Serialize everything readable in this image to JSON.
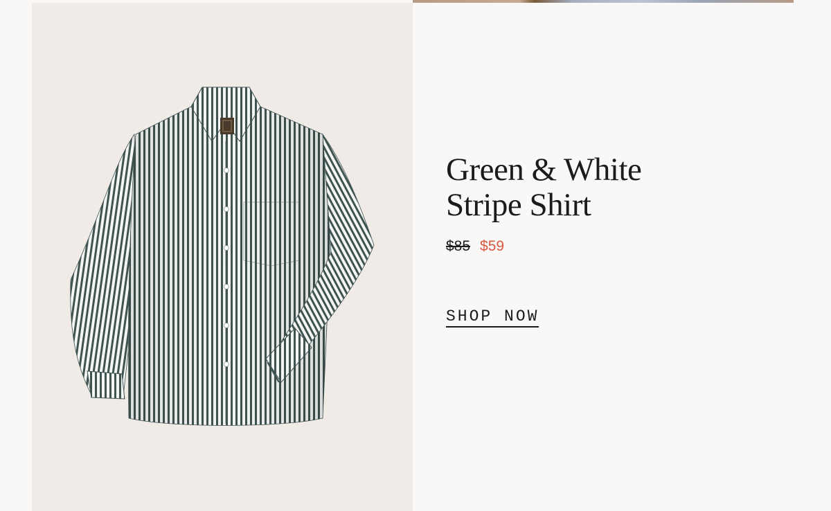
{
  "colors": {
    "page_background": "#f9f8f6",
    "image_background": "#f0ebe6",
    "sale_price": "#d9593f",
    "text": "#1b1b1b"
  },
  "product": {
    "image_alt": "green and white stripe button-down shirt",
    "title_line_1": "Green & White",
    "title_line_2": "Stripe Shirt",
    "original_price": "$85",
    "sale_price": "$59",
    "cta_label": "SHOP NOW"
  }
}
